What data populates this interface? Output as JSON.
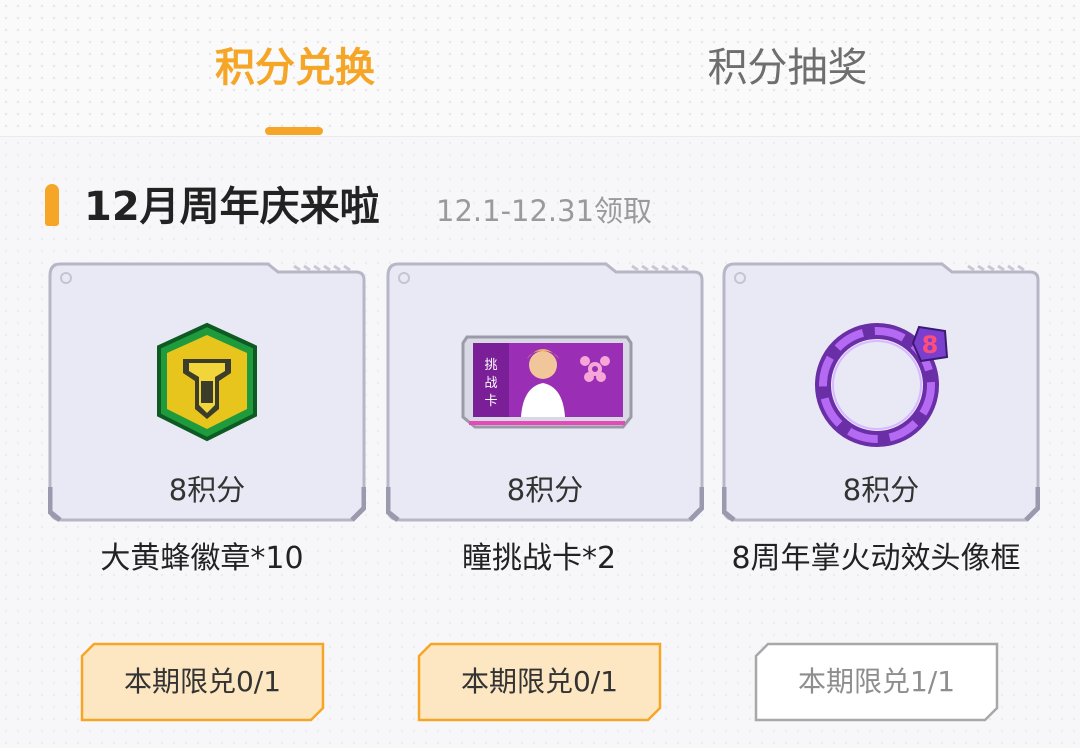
{
  "tabs": [
    {
      "label": "积分兑换",
      "active": true
    },
    {
      "label": "积分抽奖",
      "active": false
    }
  ],
  "section": {
    "title": "12月周年庆来啦",
    "date_range": "12.1-12.31领取"
  },
  "rewards": [
    {
      "icon": "hornet-badge-icon",
      "points": "8积分",
      "name": "大黄蜂徽章*10",
      "limit": "本期限兑0/1",
      "redeemable": true
    },
    {
      "icon": "challenge-card-icon",
      "points": "8积分",
      "name": "瞳挑战卡*2",
      "limit": "本期限兑0/1",
      "redeemable": true
    },
    {
      "icon": "avatar-frame-icon",
      "points": "8积分",
      "name": "8周年掌火动效头像框",
      "limit": "本期限兑1/1",
      "redeemable": false
    }
  ],
  "colors": {
    "accent": "#f6a626",
    "button_fill": "#fde7c3",
    "card_bg": "#e9e9f5"
  }
}
